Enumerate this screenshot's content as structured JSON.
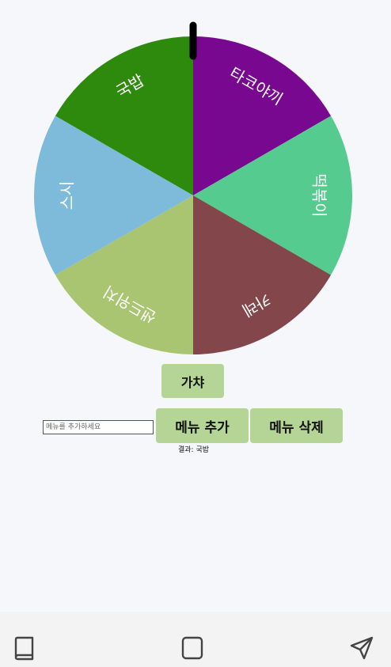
{
  "wheel": {
    "segments": [
      {
        "label": "국밥",
        "color": "#2d8a0c"
      },
      {
        "label": "타코야끼",
        "color": "#780890"
      },
      {
        "label": "떡볶이",
        "color": "#55cb8f"
      },
      {
        "label": "카레",
        "color": "#83474b"
      },
      {
        "label": "샌드위치",
        "color": "#a9c572"
      },
      {
        "label": "스시",
        "color": "#7ebbda"
      }
    ],
    "pointer_color": "#000000"
  },
  "controls": {
    "gacha_label": "가챠",
    "input_placeholder": "메뉴를 추가하세요",
    "input_value": "",
    "add_label": "메뉴 추가",
    "delete_label": "메뉴 삭제",
    "result_text": "결과: 국밥",
    "button_color": "#b4d595"
  },
  "bottom_nav": {
    "icons": [
      "book-icon",
      "square-icon",
      "send-icon"
    ]
  }
}
